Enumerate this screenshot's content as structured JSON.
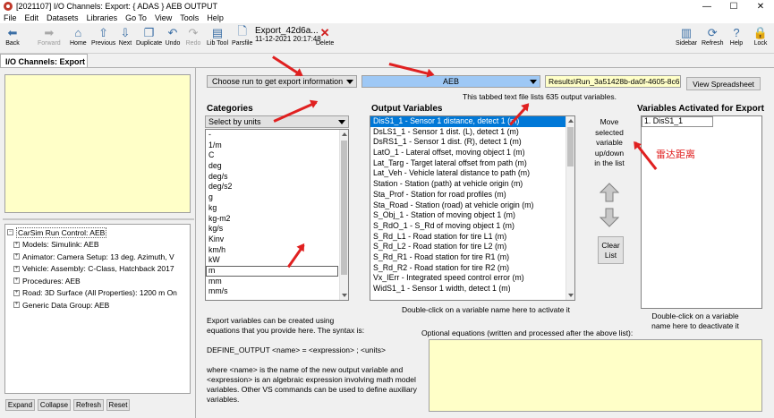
{
  "window": {
    "title": "[2021107] I/O Channels: Export: { ADAS } AEB OUTPUT",
    "min": "—",
    "max": "☐",
    "close": "✕"
  },
  "menu": [
    "File",
    "Edit",
    "Datasets",
    "Libraries",
    "Go To",
    "View",
    "Tools",
    "Help"
  ],
  "toolbar": {
    "back": "Back",
    "forward": "Forward",
    "home": "Home",
    "previous": "Previous",
    "next": "Next",
    "duplicate": "Duplicate",
    "undo": "Undo",
    "redo": "Redo",
    "libtool": "Lib Tool",
    "parsfile": "Parsfile",
    "parsfile_name": "Export_42d6a...",
    "parsfile_date": "11-12-2021 20:17:48",
    "delete": "Delete",
    "sidebar": "Sidebar",
    "refresh": "Refresh",
    "help": "Help",
    "lock": "Lock"
  },
  "tab": {
    "label": "I/O Channels: Export"
  },
  "tree": {
    "root": "CarSim Run Control: AEB",
    "children": [
      "Models: Simulink: AEB",
      "Animator: Camera Setup: 13 deg. Azimuth, V",
      "Vehicle: Assembly: C-Class, Hatchback 2017",
      "Procedures: AEB",
      "Road: 3D Surface (All Properties): 1200 m On",
      "Generic Data Group: AEB"
    ]
  },
  "left_buttons": {
    "expand": "Expand",
    "collapse": "Collapse",
    "refresh": "Refresh",
    "reset": "Reset"
  },
  "run_select": {
    "label": "Choose run to get export information"
  },
  "run_value": "AEB",
  "results_path": "Results\\Run_3a51428b-da0f-4605-8c6",
  "view_spreadsheet": "View Spreadsheet",
  "info_text": "This tabbed text file lists 635 output variables.",
  "categories": {
    "title": "Categories",
    "select_label": "Select by units",
    "items": [
      "-",
      "1/m",
      "C",
      "deg",
      "deg/s",
      "deg/s2",
      "g",
      "kg",
      "kg-m2",
      "kg/s",
      "Kinv",
      "km/h",
      "kW",
      "m",
      "mm",
      "mm/s"
    ],
    "selected_index": 13
  },
  "output_vars": {
    "title": "Output Variables",
    "items": [
      "DisS1_1 - Sensor 1 distance, detect 1 (m)",
      "DsLS1_1 - Sensor 1 dist. (L), detect 1 (m)",
      "DsRS1_1 - Sensor 1 dist. (R), detect 1 (m)",
      "LatO_1 - Lateral offset, moving object 1 (m)",
      "Lat_Targ - Target lateral offset from path (m)",
      "Lat_Veh - Vehicle lateral distance to path (m)",
      "Station - Station (path) at vehicle origin (m)",
      "Sta_Prof - Station for road profiles (m)",
      "Sta_Road - Station (road) at vehicle origin (m)",
      "S_Obj_1 - Station of moving object 1 (m)",
      "S_RdO_1 - S_Rd of moving object 1 (m)",
      "S_Rd_L1 - Road station for tire L1 (m)",
      "S_Rd_L2 - Road station for tire L2 (m)",
      "S_Rd_R1 - Road station for tire R1 (m)",
      "S_Rd_R2 - Road station for tire R2 (m)",
      "Vx_IErr - Integrated speed control error (m)",
      "WidS1_1 - Sensor 1 width, detect 1 (m)"
    ],
    "hint": "Double-click on a variable name here to activate it"
  },
  "move_text": [
    "Move",
    "selected",
    "variable",
    "up/down",
    "in the list"
  ],
  "clear_list": [
    "Clear",
    "List"
  ],
  "activated": {
    "title": "Variables Activated for Export",
    "items": [
      "1. DisS1_1"
    ],
    "hint": [
      "Double-click on a variable",
      "name here to deactivate it"
    ]
  },
  "annotation_cn": "雷达距离",
  "export_help": [
    "Export variables can be created using",
    "equations that you provide here. The syntax is:",
    "",
    "DEFINE_OUTPUT <name> = <expression> ; <units>",
    "",
    "where <name> is the name of the new output variable and",
    "<expression> is an algebraic expression involving math model",
    "variables. Other VS commands can be used to define auxiliary",
    "variables."
  ],
  "optional_eq_label": "Optional equations (written and processed after the above list):",
  "colors": {
    "accent": "#0078d7",
    "run_field": "#9ec8f5",
    "notes_bg": "#ffffc8",
    "annotation": "#e02020"
  }
}
